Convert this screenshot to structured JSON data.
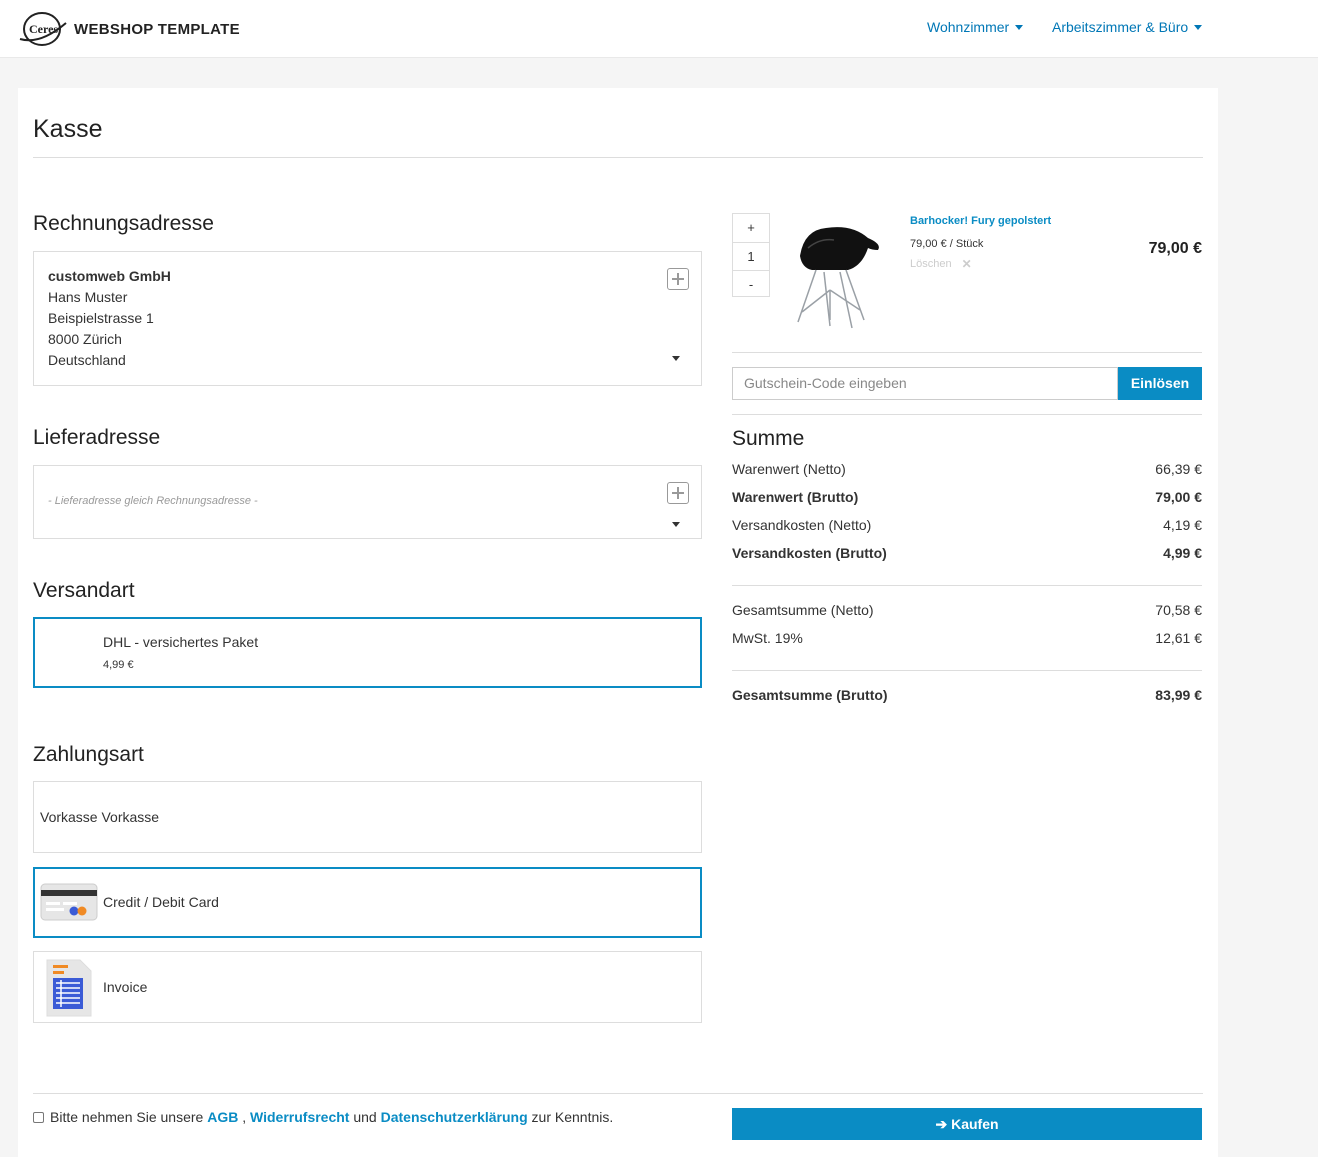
{
  "header": {
    "logo_text": "Ceres",
    "brand": "WEBSHOP TEMPLATE",
    "nav": [
      {
        "label": "Wohnzimmer"
      },
      {
        "label": "Arbeitszimmer & Büro"
      }
    ]
  },
  "page": {
    "title": "Kasse"
  },
  "billing": {
    "heading": "Rechnungsadresse",
    "company": "customweb GmbH",
    "name": "Hans Muster",
    "street": "Beispielstrasse 1",
    "city": "8000 Zürich",
    "country": "Deutschland"
  },
  "shipping_address": {
    "heading": "Lieferadresse",
    "placeholder": "- Lieferadresse gleich Rechnungsadresse -"
  },
  "shipping_method": {
    "heading": "Versandart",
    "name": "DHL - versichertes Paket",
    "price": "4,99 €"
  },
  "payment": {
    "heading": "Zahlungsart",
    "options": [
      {
        "label": "Vorkasse",
        "title": "Vorkasse"
      },
      {
        "label": "Credit / Debit Card",
        "icon": "credit-card-icon",
        "selected": true
      },
      {
        "label": "Invoice",
        "icon": "invoice-icon"
      }
    ]
  },
  "basket": {
    "qty_plus": "+",
    "qty_value": "1",
    "qty_minus": "-",
    "item_name": "Barhocker! Fury gepolstert",
    "unit_price": "79,00 € / Stück",
    "delete_label": "Löschen",
    "item_total": "79,00 €"
  },
  "voucher": {
    "placeholder": "Gutschein-Code eingeben",
    "button": "Einlösen"
  },
  "totals": {
    "heading": "Summe",
    "rows": [
      {
        "label": "Warenwert (Netto)",
        "value": "66,39 €"
      },
      {
        "label": "Warenwert (Brutto)",
        "value": "79,00 €"
      },
      {
        "label": "Versandkosten (Netto)",
        "value": "4,19 €"
      },
      {
        "label": "Versandkosten (Brutto)",
        "value": "4,99 €"
      },
      {
        "label": "Gesamtsumme (Netto)",
        "value": "70,58 €"
      },
      {
        "label": "MwSt. 19%",
        "value": "12,61 €"
      },
      {
        "label": "Gesamtsumme (Brutto)",
        "value": "83,99 €"
      }
    ]
  },
  "footer": {
    "terms_prefix": "Bitte nehmen Sie unsere",
    "agb": "AGB",
    "comma": ",",
    "withdrawal": "Widerrufsrecht",
    "and": "und",
    "privacy": "Datenschutzerklärung",
    "terms_suffix": "zur Kenntnis.",
    "buy_button": "Kaufen"
  },
  "colors": {
    "accent": "#0a8cc4",
    "link": "#0077b6"
  }
}
